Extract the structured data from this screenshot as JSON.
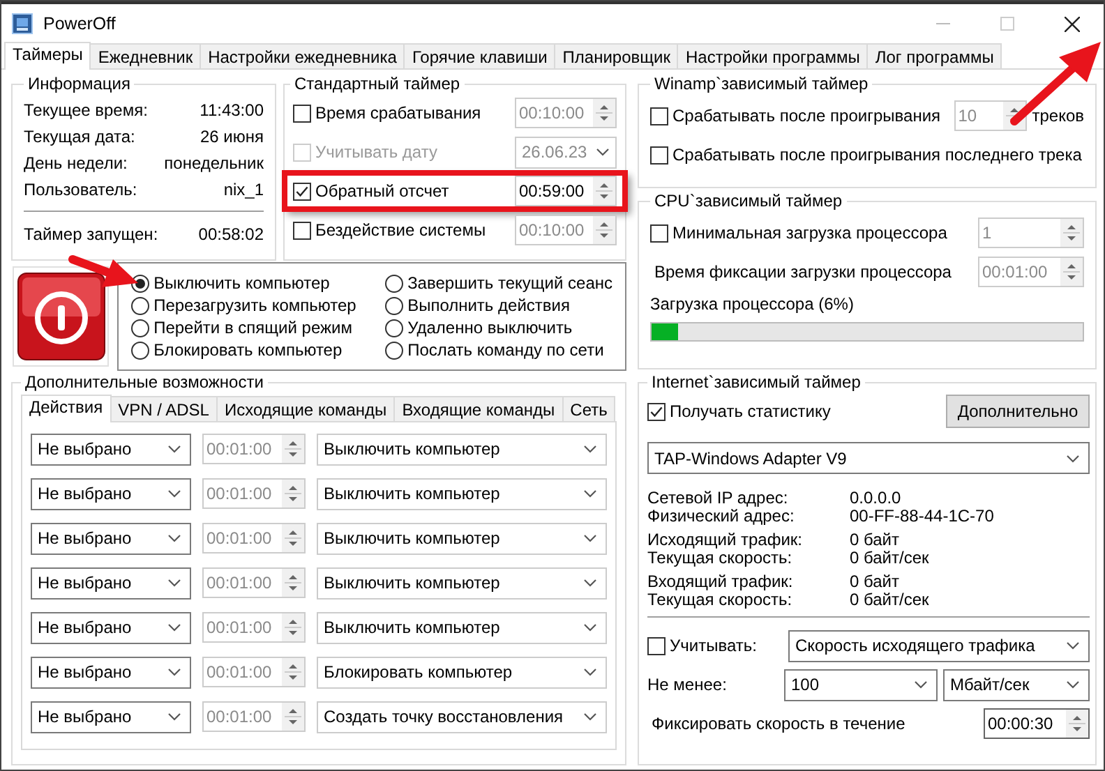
{
  "window": {
    "title": "PowerOff"
  },
  "tabs": [
    {
      "label": "Таймеры",
      "selected": true
    },
    {
      "label": "Ежедневник",
      "selected": false
    },
    {
      "label": "Настройки ежедневника",
      "selected": false
    },
    {
      "label": "Горячие клавиши",
      "selected": false
    },
    {
      "label": "Планировщик",
      "selected": false
    },
    {
      "label": "Настройки программы",
      "selected": false
    },
    {
      "label": "Лог программы",
      "selected": false
    }
  ],
  "info": {
    "title": "Информация",
    "rows": [
      {
        "label": "Текущее время:",
        "value": "11:43:00"
      },
      {
        "label": "Текущая дата:",
        "value": "26 июня"
      },
      {
        "label": "День недели:",
        "value": "понедельник"
      },
      {
        "label": "Пользователь:",
        "value": "nix_1"
      }
    ],
    "timer": {
      "label": "Таймер запущен:",
      "value": "00:58:02"
    }
  },
  "standard_timer": {
    "title": "Стандартный таймер",
    "rows": [
      {
        "kind": "spin",
        "label": "Время срабатывания",
        "checked": false,
        "disabled": false,
        "highlighted": false,
        "value": "00:10:00"
      },
      {
        "kind": "date",
        "label": "Учитывать дату",
        "checked": false,
        "disabled": true,
        "highlighted": false,
        "value": "26.06.23"
      },
      {
        "kind": "spin",
        "label": "Обратный отсчет",
        "checked": true,
        "disabled": false,
        "highlighted": true,
        "value": "00:59:00"
      },
      {
        "kind": "spin",
        "label": "Бездействие системы",
        "checked": false,
        "disabled": false,
        "highlighted": false,
        "value": "00:10:00"
      }
    ]
  },
  "actions": [
    {
      "label": "Выключить компьютер",
      "selected": true
    },
    {
      "label": "Перезагрузить компьютер",
      "selected": false
    },
    {
      "label": "Перейти в спящий режим",
      "selected": false
    },
    {
      "label": "Блокировать компьютер",
      "selected": false
    },
    {
      "label": "Завершить текущий сеанс",
      "selected": false
    },
    {
      "label": "Выполнить действия",
      "selected": false
    },
    {
      "label": "Удаленно выключить",
      "selected": false
    },
    {
      "label": "Послать команду по сети",
      "selected": false
    }
  ],
  "extra": {
    "title": "Дополнительные возможности",
    "tabs": [
      {
        "label": "Действия",
        "selected": true
      },
      {
        "label": "VPN / ADSL",
        "selected": false
      },
      {
        "label": "Исходящие команды",
        "selected": false
      },
      {
        "label": "Входящие команды",
        "selected": false
      },
      {
        "label": "Сеть",
        "selected": false
      }
    ],
    "rows": [
      {
        "source": "Не выбрано",
        "time": "00:01:00",
        "disabled": true,
        "action": "Выключить компьютер"
      },
      {
        "source": "Не выбрано",
        "time": "00:01:00",
        "disabled": true,
        "action": "Выключить компьютер"
      },
      {
        "source": "Не выбрано",
        "time": "00:01:00",
        "disabled": true,
        "action": "Выключить компьютер"
      },
      {
        "source": "Не выбрано",
        "time": "00:01:00",
        "disabled": true,
        "action": "Выключить компьютер"
      },
      {
        "source": "Не выбрано",
        "time": "00:01:00",
        "disabled": true,
        "action": "Выключить компьютер"
      },
      {
        "source": "Не выбрано",
        "time": "00:01:00",
        "disabled": true,
        "action": "Блокировать компьютер"
      },
      {
        "source": "Не выбрано",
        "time": "00:01:00",
        "disabled": true,
        "action": "Создать точку восстановления"
      }
    ]
  },
  "winamp": {
    "title": "Winamp`зависимый таймер",
    "after_tracks": {
      "label": "Срабатывать после проигрывания",
      "checked": false,
      "value": "10",
      "disabled": true,
      "suffix": "треков"
    },
    "after_last": {
      "label": "Срабатывать после проигрывания последнего трека",
      "checked": false
    }
  },
  "cpu": {
    "title": "CPU`зависимый таймер",
    "min_load": {
      "label": "Минимальная загрузка процессора",
      "checked": false,
      "value": "1",
      "disabled": true
    },
    "fix_time": {
      "label": "Время фиксации загрузки процессора",
      "value": "00:01:00",
      "disabled": true
    },
    "load": {
      "label": "Загрузка процессора (6%)",
      "level": 0.06
    }
  },
  "internet": {
    "title": "Internet`зависимый таймер",
    "stats": {
      "label": "Получать статистику",
      "checked": true
    },
    "more_button": "Дополнительно",
    "adapter": "TAP-Windows Adapter V9",
    "groups": [
      [
        {
          "label": "Сетевой IP адрес:",
          "value": "0.0.0.0"
        },
        {
          "label": "Физический адрес:",
          "value": "00-FF-88-44-1C-70"
        }
      ],
      [
        {
          "label": "Исходящий трафик:",
          "value": "0 байт"
        },
        {
          "label": "Текущая скорость:",
          "value": "0 байт/сек"
        }
      ],
      [
        {
          "label": "Входящий трафик:",
          "value": "0 байт"
        },
        {
          "label": "Текущая скорость:",
          "value": "0 байт/сек"
        }
      ]
    ],
    "consider": {
      "label": "Учитывать:",
      "checked": false,
      "value": "Скорость исходящего трафика"
    },
    "min": {
      "label": "Не менее:",
      "value": "100",
      "unit": "Мбайт/сек"
    },
    "fix": {
      "label": "Фиксировать скорость в течение",
      "value": "00:00:30",
      "disabled": false
    }
  }
}
